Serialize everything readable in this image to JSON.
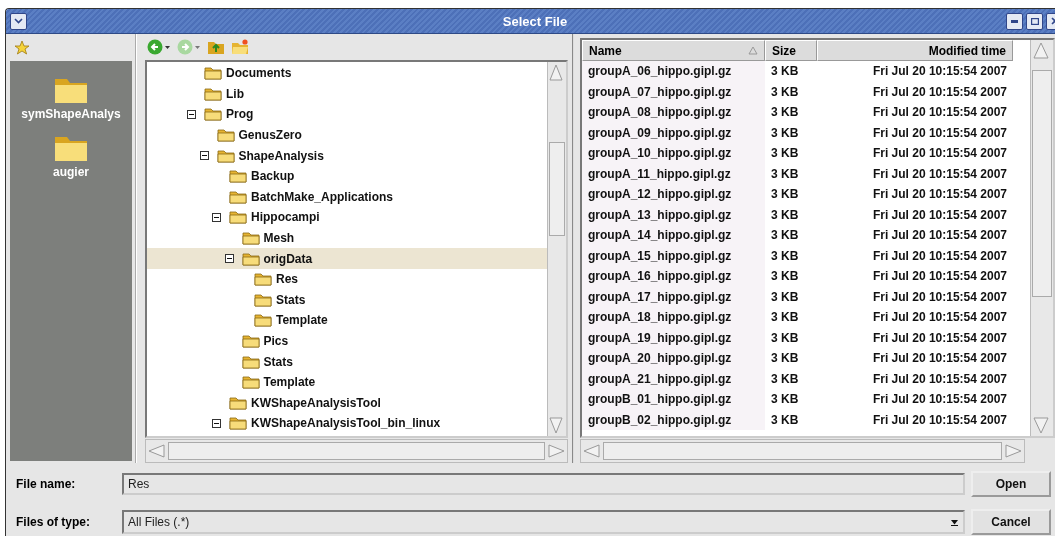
{
  "window": {
    "title": "Select File"
  },
  "sidebar": {
    "items": [
      {
        "label": "symShapeAnalys"
      },
      {
        "label": "augier"
      }
    ]
  },
  "tree": {
    "items": [
      {
        "label": "Documents",
        "selected": false
      },
      {
        "label": "Lib",
        "selected": false
      },
      {
        "label": "Prog",
        "selected": false,
        "expanded": true,
        "children": [
          {
            "label": "GenusZero",
            "selected": false
          },
          {
            "label": "ShapeAnalysis",
            "selected": false,
            "expanded": true,
            "children": [
              {
                "label": "Backup",
                "selected": false
              },
              {
                "label": "BatchMake_Applications",
                "selected": false
              },
              {
                "label": "Hippocampi",
                "selected": false,
                "expanded": true,
                "children": [
                  {
                    "label": "Mesh",
                    "selected": false
                  },
                  {
                    "label": "origData",
                    "selected": true,
                    "expanded": true,
                    "children": [
                      {
                        "label": "Res",
                        "selected": false
                      },
                      {
                        "label": "Stats",
                        "selected": false
                      },
                      {
                        "label": "Template",
                        "selected": false
                      }
                    ]
                  },
                  {
                    "label": "Pics",
                    "selected": false
                  },
                  {
                    "label": "Stats",
                    "selected": false
                  },
                  {
                    "label": "Template",
                    "selected": false
                  }
                ]
              },
              {
                "label": "KWShapeAnalysisTool",
                "selected": false
              },
              {
                "label": "KWShapeAnalysisTool_bin_linux",
                "selected": false,
                "expanded": true
              }
            ]
          }
        ]
      }
    ]
  },
  "file_list": {
    "columns": [
      {
        "label": "Name",
        "sorted": true
      },
      {
        "label": "Size",
        "sorted": false
      },
      {
        "label": "Modified time",
        "sorted": false
      }
    ],
    "rows": [
      {
        "name": "groupA_06_hippo.gipl.gz",
        "size": "3 KB",
        "modified": "Fri Jul 20 10:15:54 2007"
      },
      {
        "name": "groupA_07_hippo.gipl.gz",
        "size": "3 KB",
        "modified": "Fri Jul 20 10:15:54 2007"
      },
      {
        "name": "groupA_08_hippo.gipl.gz",
        "size": "3 KB",
        "modified": "Fri Jul 20 10:15:54 2007"
      },
      {
        "name": "groupA_09_hippo.gipl.gz",
        "size": "3 KB",
        "modified": "Fri Jul 20 10:15:54 2007"
      },
      {
        "name": "groupA_10_hippo.gipl.gz",
        "size": "3 KB",
        "modified": "Fri Jul 20 10:15:54 2007"
      },
      {
        "name": "groupA_11_hippo.gipl.gz",
        "size": "3 KB",
        "modified": "Fri Jul 20 10:15:54 2007"
      },
      {
        "name": "groupA_12_hippo.gipl.gz",
        "size": "3 KB",
        "modified": "Fri Jul 20 10:15:54 2007"
      },
      {
        "name": "groupA_13_hippo.gipl.gz",
        "size": "3 KB",
        "modified": "Fri Jul 20 10:15:54 2007"
      },
      {
        "name": "groupA_14_hippo.gipl.gz",
        "size": "3 KB",
        "modified": "Fri Jul 20 10:15:54 2007"
      },
      {
        "name": "groupA_15_hippo.gipl.gz",
        "size": "3 KB",
        "modified": "Fri Jul 20 10:15:54 2007"
      },
      {
        "name": "groupA_16_hippo.gipl.gz",
        "size": "3 KB",
        "modified": "Fri Jul 20 10:15:54 2007"
      },
      {
        "name": "groupA_17_hippo.gipl.gz",
        "size": "3 KB",
        "modified": "Fri Jul 20 10:15:54 2007"
      },
      {
        "name": "groupA_18_hippo.gipl.gz",
        "size": "3 KB",
        "modified": "Fri Jul 20 10:15:54 2007"
      },
      {
        "name": "groupA_19_hippo.gipl.gz",
        "size": "3 KB",
        "modified": "Fri Jul 20 10:15:54 2007"
      },
      {
        "name": "groupA_20_hippo.gipl.gz",
        "size": "3 KB",
        "modified": "Fri Jul 20 10:15:54 2007"
      },
      {
        "name": "groupA_21_hippo.gipl.gz",
        "size": "3 KB",
        "modified": "Fri Jul 20 10:15:54 2007"
      },
      {
        "name": "groupB_01_hippo.gipl.gz",
        "size": "3 KB",
        "modified": "Fri Jul 20 10:15:54 2007"
      },
      {
        "name": "groupB_02_hippo.gipl.gz",
        "size": "3 KB",
        "modified": "Fri Jul 20 10:15:54 2007"
      }
    ]
  },
  "file_name": {
    "label": "File name:",
    "value": "Res"
  },
  "file_type": {
    "label": "Files of type:",
    "value": "All Files (.*)"
  },
  "buttons": [
    {
      "label": "Open"
    },
    {
      "label": "Cancel"
    }
  ]
}
